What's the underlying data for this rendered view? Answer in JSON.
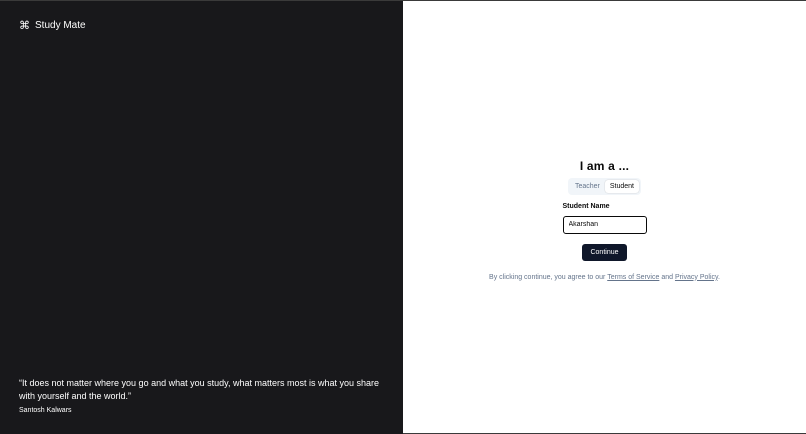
{
  "brand": {
    "icon": "command-icon",
    "name": "Study Mate"
  },
  "testimonial": {
    "quote": "“It does not matter where you go and what you study, what matters most is what you share with yourself and the world.”",
    "author": "Santosh Kalwars"
  },
  "form": {
    "heading": "I am a ...",
    "tabs": [
      {
        "label": "Teacher",
        "active": false
      },
      {
        "label": "Student",
        "active": true
      }
    ],
    "field_label": "Student Name",
    "field_value": "Akarshan",
    "continue_label": "Continue"
  },
  "terms": {
    "prefix": "By clicking continue, you agree to our",
    "tos_label": "Terms of Service",
    "and": "and",
    "privacy_label": "Privacy Policy",
    "suffix": "."
  },
  "colors": {
    "left_panel_bg": "#18181b",
    "button_bg": "#0f172a",
    "muted_text": "#64748b"
  }
}
